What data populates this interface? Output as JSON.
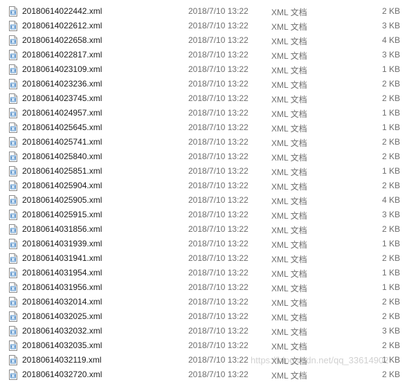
{
  "files": [
    {
      "name": "20180614022442.xml",
      "modified": "2018/7/10 13:22",
      "type": "XML 文档",
      "size": "2 KB"
    },
    {
      "name": "20180614022612.xml",
      "modified": "2018/7/10 13:22",
      "type": "XML 文档",
      "size": "3 KB"
    },
    {
      "name": "20180614022658.xml",
      "modified": "2018/7/10 13:22",
      "type": "XML 文档",
      "size": "4 KB"
    },
    {
      "name": "20180614022817.xml",
      "modified": "2018/7/10 13:22",
      "type": "XML 文档",
      "size": "3 KB"
    },
    {
      "name": "20180614023109.xml",
      "modified": "2018/7/10 13:22",
      "type": "XML 文档",
      "size": "1 KB"
    },
    {
      "name": "20180614023236.xml",
      "modified": "2018/7/10 13:22",
      "type": "XML 文档",
      "size": "2 KB"
    },
    {
      "name": "20180614023745.xml",
      "modified": "2018/7/10 13:22",
      "type": "XML 文档",
      "size": "2 KB"
    },
    {
      "name": "20180614024957.xml",
      "modified": "2018/7/10 13:22",
      "type": "XML 文档",
      "size": "1 KB"
    },
    {
      "name": "20180614025645.xml",
      "modified": "2018/7/10 13:22",
      "type": "XML 文档",
      "size": "1 KB"
    },
    {
      "name": "20180614025741.xml",
      "modified": "2018/7/10 13:22",
      "type": "XML 文档",
      "size": "2 KB"
    },
    {
      "name": "20180614025840.xml",
      "modified": "2018/7/10 13:22",
      "type": "XML 文档",
      "size": "2 KB"
    },
    {
      "name": "20180614025851.xml",
      "modified": "2018/7/10 13:22",
      "type": "XML 文档",
      "size": "1 KB"
    },
    {
      "name": "20180614025904.xml",
      "modified": "2018/7/10 13:22",
      "type": "XML 文档",
      "size": "2 KB"
    },
    {
      "name": "20180614025905.xml",
      "modified": "2018/7/10 13:22",
      "type": "XML 文档",
      "size": "4 KB"
    },
    {
      "name": "20180614025915.xml",
      "modified": "2018/7/10 13:22",
      "type": "XML 文档",
      "size": "3 KB"
    },
    {
      "name": "20180614031856.xml",
      "modified": "2018/7/10 13:22",
      "type": "XML 文档",
      "size": "2 KB"
    },
    {
      "name": "20180614031939.xml",
      "modified": "2018/7/10 13:22",
      "type": "XML 文档",
      "size": "1 KB"
    },
    {
      "name": "20180614031941.xml",
      "modified": "2018/7/10 13:22",
      "type": "XML 文档",
      "size": "2 KB"
    },
    {
      "name": "20180614031954.xml",
      "modified": "2018/7/10 13:22",
      "type": "XML 文档",
      "size": "1 KB"
    },
    {
      "name": "20180614031956.xml",
      "modified": "2018/7/10 13:22",
      "type": "XML 文档",
      "size": "1 KB"
    },
    {
      "name": "20180614032014.xml",
      "modified": "2018/7/10 13:22",
      "type": "XML 文档",
      "size": "2 KB"
    },
    {
      "name": "20180614032025.xml",
      "modified": "2018/7/10 13:22",
      "type": "XML 文档",
      "size": "2 KB"
    },
    {
      "name": "20180614032032.xml",
      "modified": "2018/7/10 13:22",
      "type": "XML 文档",
      "size": "3 KB"
    },
    {
      "name": "20180614032035.xml",
      "modified": "2018/7/10 13:22",
      "type": "XML 文档",
      "size": "2 KB"
    },
    {
      "name": "20180614032119.xml",
      "modified": "2018/7/10 13:22",
      "type": "XML 文档",
      "size": "1 KB"
    },
    {
      "name": "20180614032720.xml",
      "modified": "2018/7/10 13:22",
      "type": "XML 文档",
      "size": "2 KB"
    }
  ],
  "watermark": "https://blog.csdn.net/qq_33614902",
  "icon": "xml-file-icon",
  "colors": {
    "name_text": "#1a1a1a",
    "meta_text": "#6d6d6d",
    "background": "#ffffff"
  }
}
